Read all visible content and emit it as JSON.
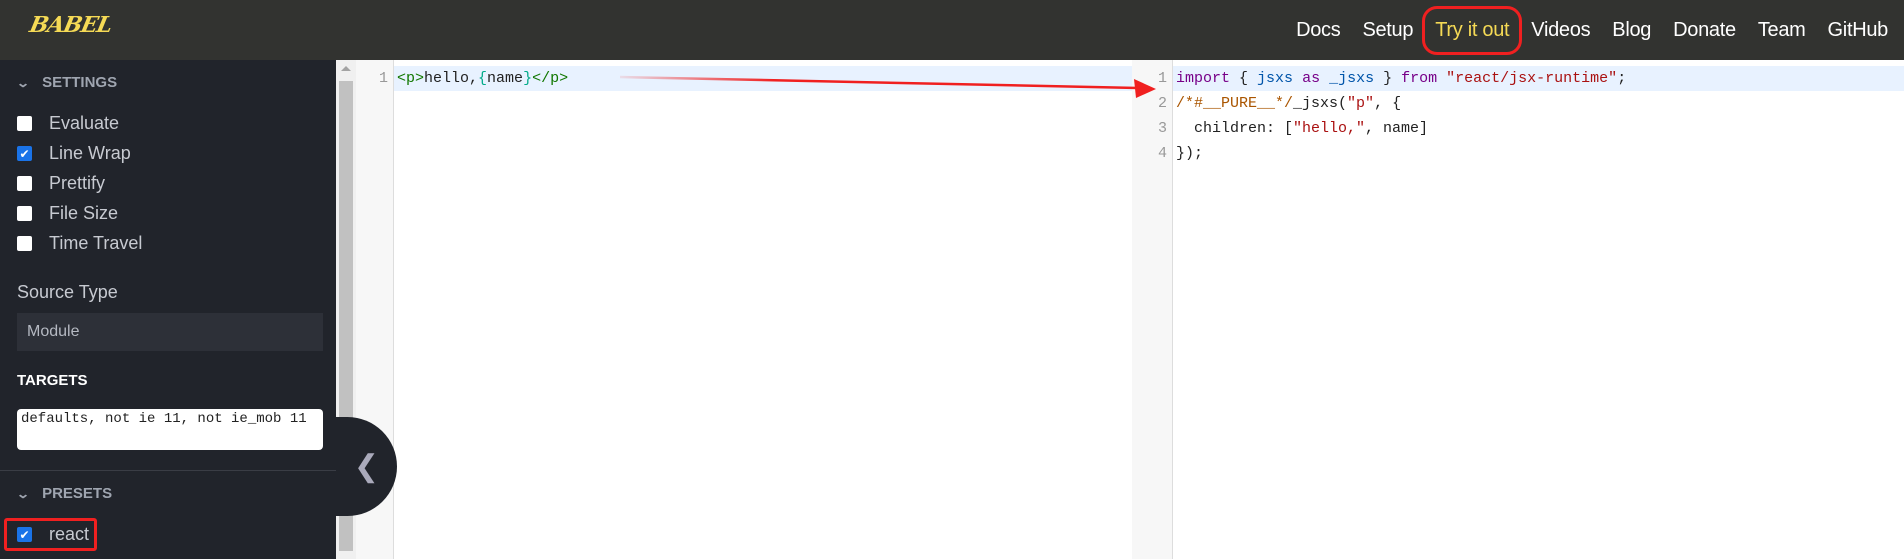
{
  "header": {
    "logo": "BABEL",
    "nav": [
      "Docs",
      "Setup",
      "Try it out",
      "Videos",
      "Blog",
      "Donate",
      "Team",
      "GitHub"
    ],
    "active": "Try it out"
  },
  "sidebar": {
    "settings_title": "SETTINGS",
    "settings": [
      {
        "label": "Evaluate",
        "checked": false
      },
      {
        "label": "Line Wrap",
        "checked": true
      },
      {
        "label": "Prettify",
        "checked": false
      },
      {
        "label": "File Size",
        "checked": false
      },
      {
        "label": "Time Travel",
        "checked": false
      }
    ],
    "source_type_label": "Source Type",
    "source_type_value": "Module",
    "targets_label": "TARGETS",
    "targets_value": "defaults, not ie 11, not ie_mob 11",
    "presets_title": "PRESETS",
    "presets": [
      {
        "label": "react",
        "checked": true
      }
    ]
  },
  "input_editor": {
    "lines": [
      "<p>hello,{name}</p>"
    ]
  },
  "output_editor": {
    "lines": [
      "import { jsxs as _jsxs } from \"react/jsx-runtime\";",
      "/*#__PURE__*/_jsxs(\"p\", {",
      "  children: [\"hello,\", name]",
      "});"
    ]
  },
  "colors": {
    "header_bg": "#323330",
    "sidebar_bg": "#21242b",
    "accent": "#f5da55",
    "annotation": "#f02020",
    "checkbox": "#1a73e8"
  },
  "icons": {
    "collapse": "chevron-left-icon",
    "section": "chevron-down-icon"
  }
}
